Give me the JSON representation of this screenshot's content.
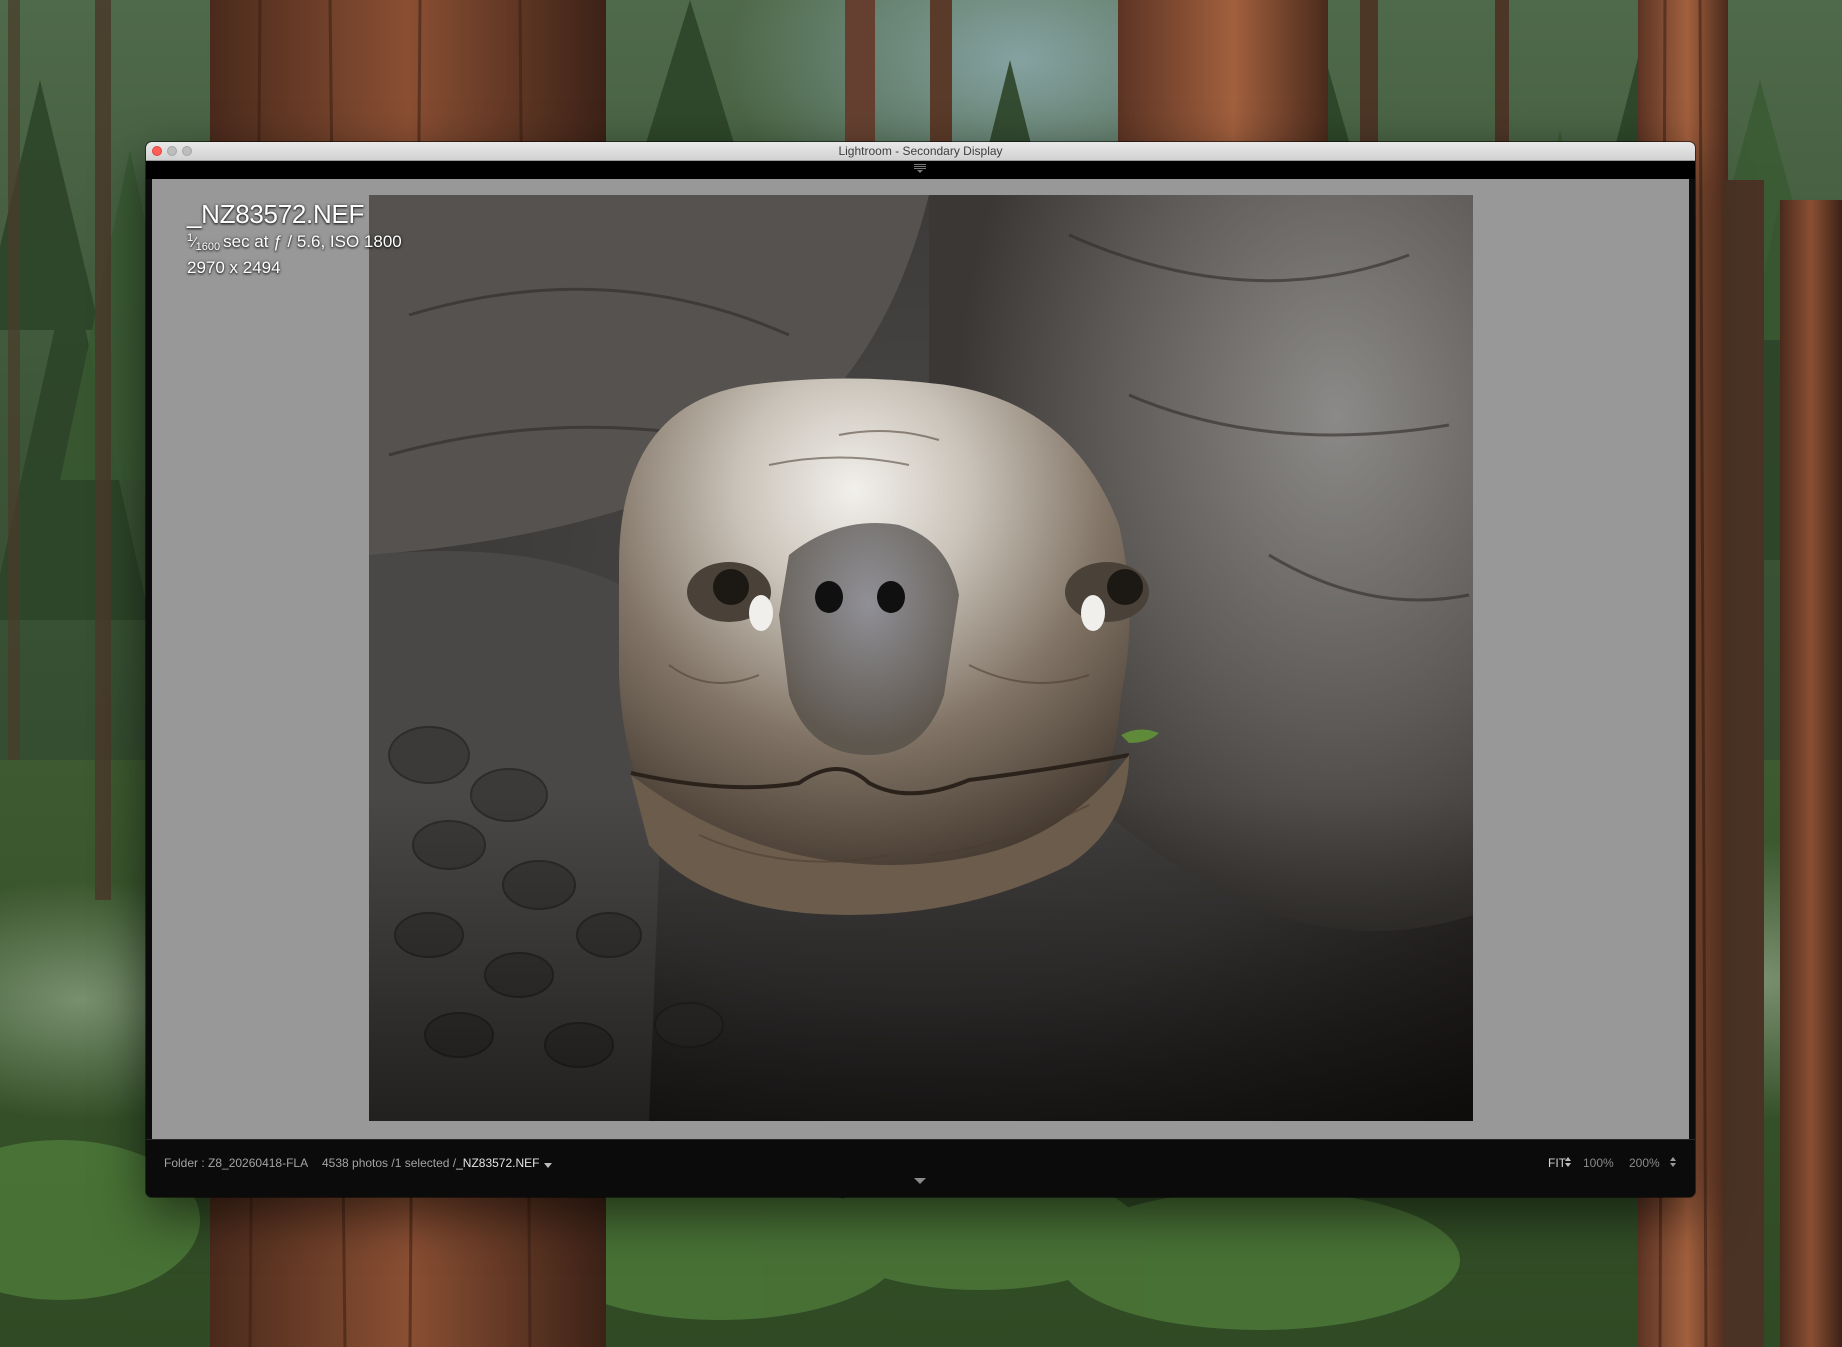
{
  "window": {
    "title": "Lightroom - Secondary Display"
  },
  "photo": {
    "filename": "_NZ83572.NEF",
    "shutter_num": "1",
    "shutter_den": "1600",
    "exif_rest": "sec at ƒ / 5.6, ISO 1800",
    "dimensions": "2970 x 2494"
  },
  "bottom_bar": {
    "folder": "Folder : Z8_20260418-FLA",
    "count": "4538 photos /1 selected /",
    "selected_file": "_NZ83572.NEF"
  },
  "zoom": {
    "fit": "FIT",
    "level_1": "100%",
    "level_2": "200%"
  },
  "icons": {
    "close": "close-traffic-light",
    "minimize": "minimize-traffic-light",
    "maximize": "maximize-traffic-light",
    "top_panel_toggle": "panel-collapse-icon",
    "bottom_panel_toggle": "chevron-down-icon"
  },
  "colors": {
    "loupe_background": "#989898",
    "window_chrome": "#0c0c0c",
    "close_button": "#fe5f57"
  }
}
